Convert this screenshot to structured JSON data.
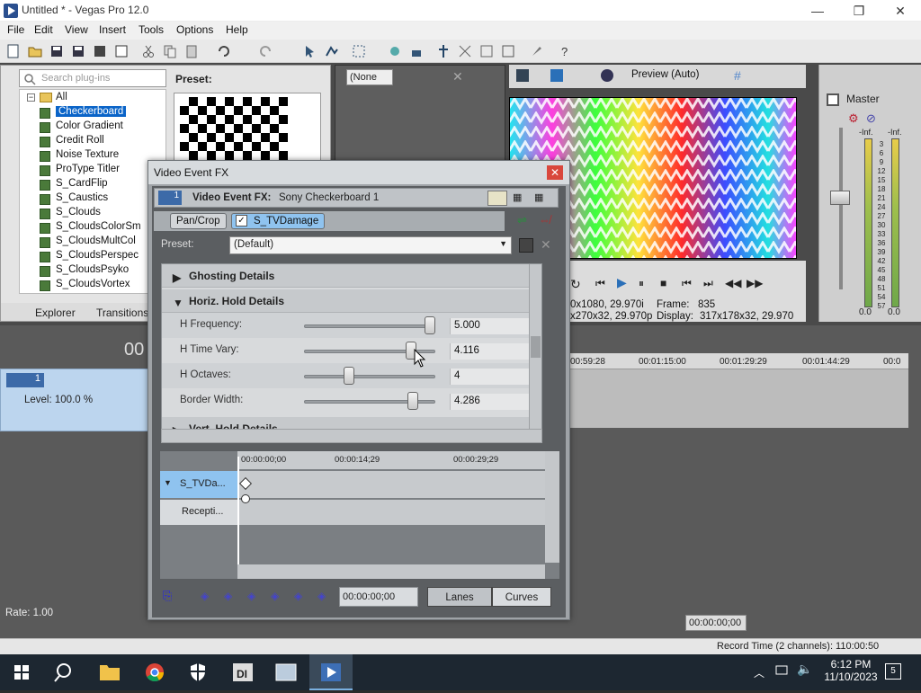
{
  "window": {
    "title": "Untitled * - Vegas Pro 12.0",
    "minimize": "—",
    "maximize": "❐",
    "close": "✕"
  },
  "menu": [
    "File",
    "Edit",
    "View",
    "Insert",
    "Tools",
    "Options",
    "Help"
  ],
  "plugins": {
    "search_placeholder": "Search plug-ins",
    "root": "All",
    "items": [
      "Checkerboard",
      "Color Gradient",
      "Credit Roll",
      "Noise Texture",
      "ProType Titler",
      "S_CardFlip",
      "S_Caustics",
      "S_Clouds",
      "S_CloudsColorSm",
      "S_CloudsMultCol",
      "S_CloudsPerspec",
      "S_CloudsPsyko",
      "S_CloudsVortex"
    ],
    "selected_index": 0,
    "preset_label": "Preset:",
    "tabs": [
      "Explorer",
      "Transitions"
    ]
  },
  "trimmer": {
    "dropdown": "(None"
  },
  "preview": {
    "mode": "Preview (Auto)",
    "project_info": "0x1080, 29.970i",
    "preview_info": "x270x32, 29.970p",
    "frame_label": "Frame:",
    "frame_value": "835",
    "display_label": "Display:",
    "display_value": "317x178x32, 29.970"
  },
  "master": {
    "label": "Master",
    "scale": [
      "-Inf.",
      "3",
      "6",
      "9",
      "12",
      "15",
      "18",
      "21",
      "24",
      "27",
      "30",
      "33",
      "36",
      "39",
      "42",
      "45",
      "48",
      "51",
      "54",
      "57"
    ],
    "left_value": "0.0",
    "right_value": "0.0",
    "inf_left": "-Inf.",
    "inf_right": "-Inf."
  },
  "timeline": {
    "timecode_partial": "00",
    "ticks": [
      "00:59:28",
      "00:01:15:00",
      "00:01:29:29",
      "00:01:44:29",
      "00:0"
    ],
    "track_number": "1",
    "track_level": "Level: 100.0 %",
    "rate": "Rate: 1.00",
    "bottom_timecode": "00:00:00;00",
    "record_time": "Record Time (2 channels): 110:00:50"
  },
  "dialog": {
    "title": "Video Event FX",
    "header_label": "Video Event FX:",
    "header_value": "Sony Checkerboard 1",
    "track_badge": "1",
    "chain": [
      "Pan/Crop",
      "S_TVDamage"
    ],
    "preset_label": "Preset:",
    "preset_value": "(Default)",
    "groups": {
      "ghosting": "Ghosting Details",
      "horiz": "Horiz. Hold Details",
      "vert": "Vert. Hold Details"
    },
    "params": [
      {
        "label": "H Frequency:",
        "value": "5.000",
        "level": 1.0
      },
      {
        "label": "H Time Vary:",
        "value": "4.116",
        "level": 0.84
      },
      {
        "label": "H Octaves:",
        "value": "4",
        "level": 0.33
      },
      {
        "label": "Border Width:",
        "value": "4.286",
        "level": 0.86
      }
    ],
    "keyframes": {
      "ruler": [
        "00:00:00;00",
        "00:00:14;29",
        "00:00:29;29"
      ],
      "lanes": [
        "S_TVDa...",
        "Recepti..."
      ],
      "timecode": "00:00:00;00",
      "lanes_btn": "Lanes",
      "curves_btn": "Curves"
    }
  },
  "taskbar": {
    "time": "6:12 PM",
    "date": "11/10/2023",
    "notifications": "5",
    "apps": [
      "start-icon",
      "search-icon",
      "file-explorer-icon",
      "chrome-icon",
      "shield-icon",
      "davinci-icon",
      "app-icon",
      "vegas-icon"
    ]
  },
  "colors": {
    "selection": "#0a64c8",
    "dialog_bg": "#5b5e61",
    "lane_active": "#8fc3ef",
    "close_red": "#d9473c"
  }
}
